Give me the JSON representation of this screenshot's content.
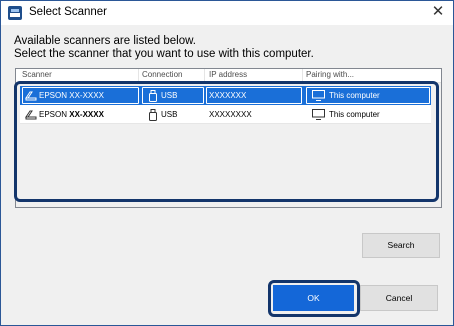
{
  "window": {
    "title": "Select Scanner",
    "close_glyph": "✕",
    "icon": "scanner-app-icon"
  },
  "intro": {
    "line1": "Available scanners are listed below.",
    "line2": "Select the scanner that you want to use with this computer."
  },
  "table": {
    "columns": [
      "Scanner",
      "Connection",
      "IP address",
      "Pairing with..."
    ],
    "rows": [
      {
        "scanner_prefix": "EPSON",
        "scanner_model": "XX-XXXX",
        "connection": "USB",
        "ip": "XXXXXXX",
        "pairing": "This computer",
        "selected": true
      },
      {
        "scanner_prefix": "EPSON",
        "scanner_model": "XX-XXXX",
        "connection": "USB",
        "ip": "XXXXXXXX",
        "pairing": "This computer",
        "selected": false
      }
    ]
  },
  "buttons": {
    "search": "Search",
    "ok": "OK",
    "cancel": "Cancel"
  },
  "colors": {
    "selection": "#1a6fd8",
    "focus_ring": "#13356b",
    "primary_button": "#1467d8"
  },
  "icons": {
    "scanner": "scanner-icon",
    "usb": "usb-icon",
    "monitor": "monitor-icon"
  }
}
